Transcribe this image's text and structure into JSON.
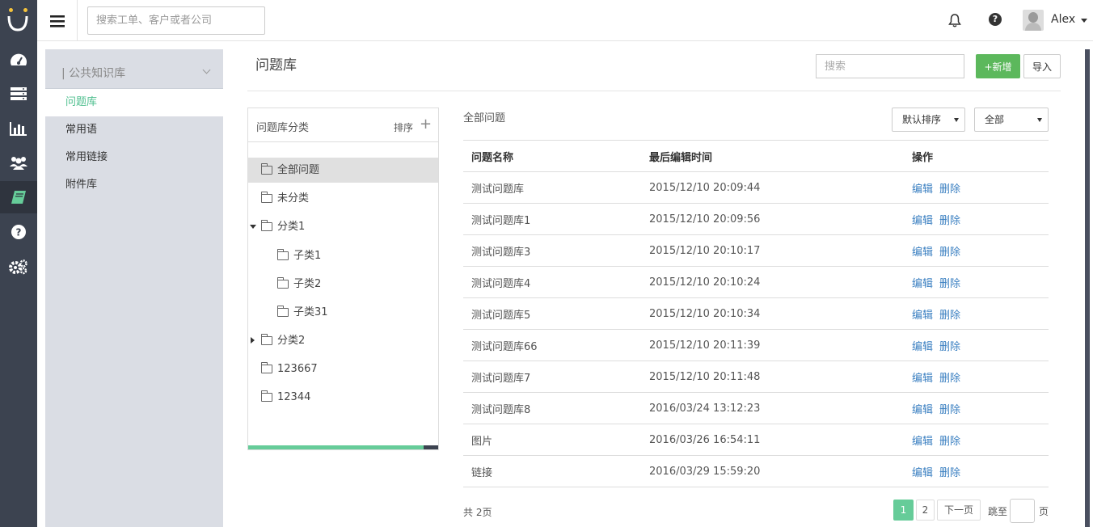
{
  "topbar": {
    "search_placeholder": "搜索工单、客户或者公司",
    "username": "Alex"
  },
  "rail": {
    "icons": [
      "dashboard-icon",
      "server-icon",
      "bar-chart-icon",
      "users-icon",
      "book-icon",
      "help-icon",
      "settings-icon"
    ],
    "active": "book-icon"
  },
  "sidebar": {
    "header": "| 公共知识库",
    "items": [
      {
        "label": "问题库",
        "active": true
      },
      {
        "label": "常用语"
      },
      {
        "label": "常用链接"
      },
      {
        "label": "附件库"
      }
    ]
  },
  "main": {
    "title": "问题库",
    "search_placeholder": "搜索",
    "add_label": "+新增",
    "import_label": "导入"
  },
  "categories": {
    "title": "问题库分类",
    "sort_label": "排序",
    "add_symbol": "+",
    "nodes": [
      {
        "label": "全部问题",
        "selected": true
      },
      {
        "label": "未分类"
      },
      {
        "label": "分类1",
        "expanded": true
      },
      {
        "label": "子类1"
      },
      {
        "label": "子类2"
      },
      {
        "label": "子类31"
      },
      {
        "label": "分类2",
        "collapsed": true
      },
      {
        "label": "123667"
      },
      {
        "label": "12344"
      }
    ]
  },
  "questions": {
    "title": "全部问题",
    "sort_select": "默认排序",
    "filter_select": "全部",
    "columns": [
      "问题名称",
      "最后编辑时间",
      "操作"
    ],
    "edit_label": "编辑",
    "delete_label": "删除",
    "rows": [
      {
        "name": "测试问题库",
        "time": "2015/12/10 20:09:44"
      },
      {
        "name": "测试问题库1",
        "time": "2015/12/10 20:09:56"
      },
      {
        "name": "测试问题库3",
        "time": "2015/12/10 20:10:17"
      },
      {
        "name": "测试问题库4",
        "time": "2015/12/10 20:10:24"
      },
      {
        "name": "测试问题库5",
        "time": "2015/12/10 20:10:34"
      },
      {
        "name": "测试问题库66",
        "time": "2015/12/10 20:11:39"
      },
      {
        "name": "测试问题库7",
        "time": "2015/12/10 20:11:48"
      },
      {
        "name": "测试问题库8",
        "time": "2016/03/24 13:12:23"
      },
      {
        "name": "图片",
        "time": "2016/03/26 16:54:11"
      },
      {
        "name": "链接",
        "time": "2016/03/29 15:59:20"
      }
    ]
  },
  "pagination": {
    "total": "共  2页",
    "pages": [
      "1",
      "2"
    ],
    "current": "1",
    "next_label": "下一页",
    "jump_label": "跳至",
    "page_word": "页"
  },
  "colors": {
    "accent": "#66cc99",
    "rail": "#3c4350",
    "link": "#3a7fc1"
  }
}
